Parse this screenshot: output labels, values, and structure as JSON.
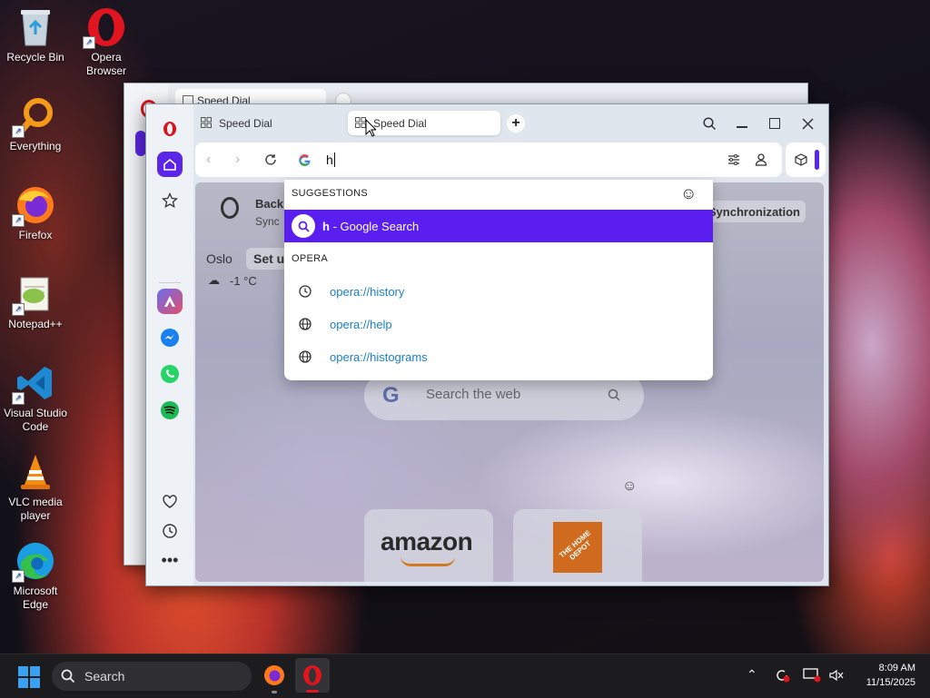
{
  "desktop": {
    "icons": [
      {
        "label": "Recycle Bin"
      },
      {
        "label": "Opera Browser"
      },
      {
        "label": "Everything"
      },
      {
        "label": "Firefox"
      },
      {
        "label": "Notepad++"
      },
      {
        "label": "Visual Studio Code"
      },
      {
        "label": "VLC media player"
      },
      {
        "label": "Microsoft Edge"
      }
    ]
  },
  "back_window": {
    "tab_label": "Speed Dial"
  },
  "browser": {
    "tabs": [
      {
        "label": "Speed Dial"
      },
      {
        "label": "Speed Dial"
      }
    ],
    "address": {
      "value": "h",
      "search_engine": "google-icon"
    },
    "dropdown": {
      "suggestions_header": "SUGGESTIONS",
      "google_query": "h",
      "google_suffix": " - Google Search",
      "opera_header": "OPERA",
      "opera_items": [
        {
          "label": "opera://history",
          "icon": "clock-icon"
        },
        {
          "label": "opera://help",
          "icon": "globe-icon"
        },
        {
          "label": "opera://histograms",
          "icon": "globe-icon"
        }
      ]
    },
    "speed_dial": {
      "account_title": "Back",
      "account_sub": "Sync",
      "sync_button": "Synchronization",
      "weather_city": "Oslo",
      "weather_setup": "Set u",
      "weather_temp": "-1 °C",
      "search_placeholder": "Search the web",
      "tiles": [
        {
          "label": "amazon"
        },
        {
          "label": "THE HOME DEPOT"
        }
      ]
    }
  },
  "taskbar": {
    "search_label": "Search",
    "time": "8:09 AM",
    "date": "11/15/2025"
  },
  "colors": {
    "opera_red": "#d9121c",
    "opera_accent": "#5b26e8",
    "highlight_purple": "#5a1ff0",
    "link_blue": "#1a7fc9"
  }
}
